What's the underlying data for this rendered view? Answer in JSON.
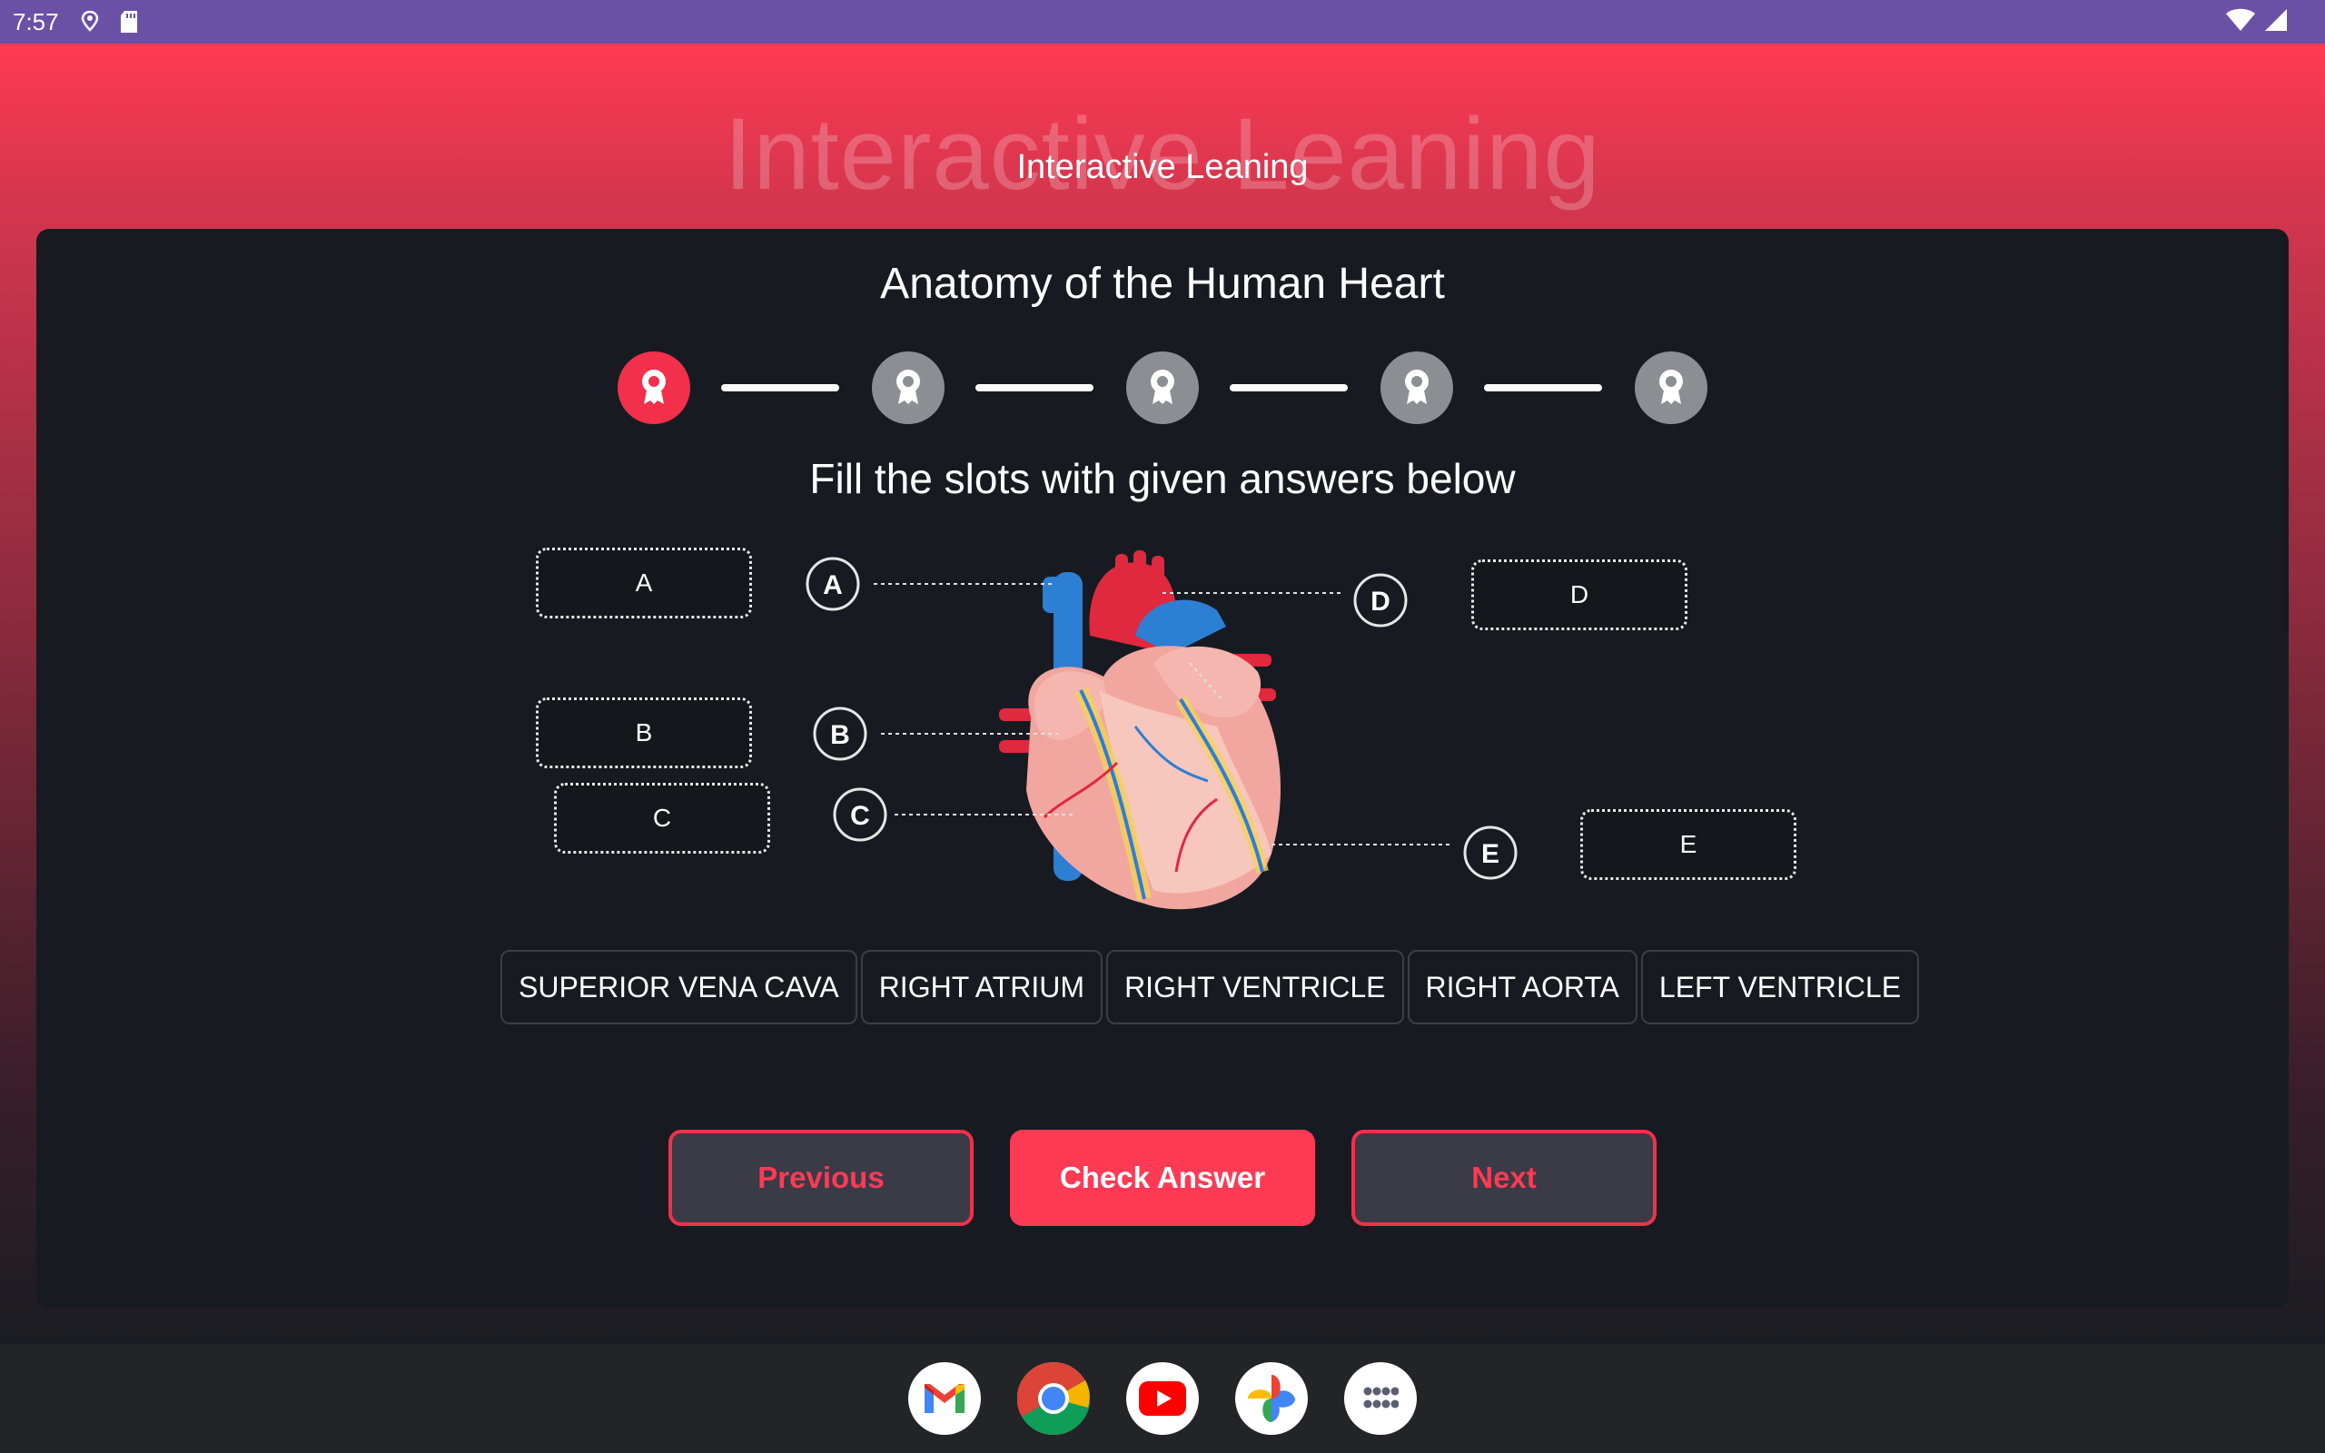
{
  "status_bar": {
    "time": "7:57",
    "left_icons": [
      "location-icon",
      "sd-card-icon"
    ],
    "right_icons": [
      "wifi-icon",
      "signal-icon"
    ]
  },
  "app": {
    "watermark_title": "Interactive Leaning",
    "title": "Interactive Leaning"
  },
  "lesson": {
    "title": "Anatomy of the Human Heart",
    "instruction": "Fill the slots with given answers below",
    "steps": [
      {
        "icon": "award-icon",
        "active": true
      },
      {
        "icon": "award-icon",
        "active": false
      },
      {
        "icon": "award-icon",
        "active": false
      },
      {
        "icon": "award-icon",
        "active": false
      },
      {
        "icon": "award-icon",
        "active": false
      }
    ]
  },
  "slots": {
    "a": "A",
    "b": "B",
    "c": "C",
    "d": "D",
    "e": "E"
  },
  "markers": {
    "a": "A",
    "b": "B",
    "c": "C",
    "d": "D",
    "e": "E"
  },
  "answers": [
    "SUPERIOR VENA CAVA",
    "RIGHT ATRIUM",
    "RIGHT VENTRICLE",
    "RIGHT AORTA",
    "LEFT VENTRICLE"
  ],
  "buttons": {
    "previous": "Previous",
    "check": "Check Answer",
    "next": "Next"
  },
  "colors": {
    "accent": "#ff3a55",
    "status_bar": "#6b51a6",
    "card": "#171b21",
    "inactive_step": "#8b8e93"
  },
  "dock": [
    "gmail-icon",
    "chrome-icon",
    "youtube-icon",
    "photos-icon",
    "app-drawer-icon"
  ]
}
